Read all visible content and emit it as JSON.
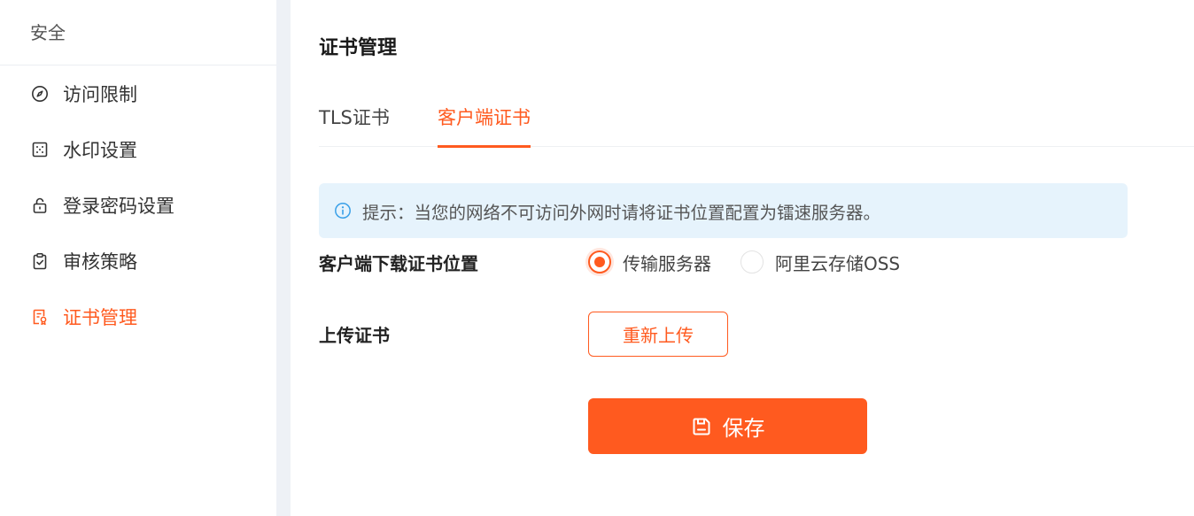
{
  "sidebar": {
    "header": "安全",
    "items": [
      {
        "label": "访问限制",
        "icon": "compass-icon"
      },
      {
        "label": "水印设置",
        "icon": "watermark-icon"
      },
      {
        "label": "登录密码设置",
        "icon": "lock-icon"
      },
      {
        "label": "审核策略",
        "icon": "clipboard-check-icon"
      },
      {
        "label": "证书管理",
        "icon": "certificate-icon",
        "active": true
      }
    ]
  },
  "main": {
    "title": "证书管理",
    "tabs": [
      {
        "label": "TLS证书"
      },
      {
        "label": "客户端证书",
        "active": true
      }
    ],
    "tip": {
      "icon": "info-icon",
      "text": "提示：当您的网络不可访问外网时请将证书位置配置为镭速服务器。"
    },
    "download_location": {
      "label": "客户端下载证书位置",
      "options": [
        {
          "label": "传输服务器",
          "checked": true
        },
        {
          "label": "阿里云存储OSS",
          "checked": false
        }
      ]
    },
    "upload": {
      "label": "上传证书",
      "button": "重新上传"
    },
    "save_button": "保存"
  },
  "colors": {
    "accent": "#ff5a1f",
    "tip_background": "#e6f3fc",
    "info_icon": "#3aa0e8"
  }
}
